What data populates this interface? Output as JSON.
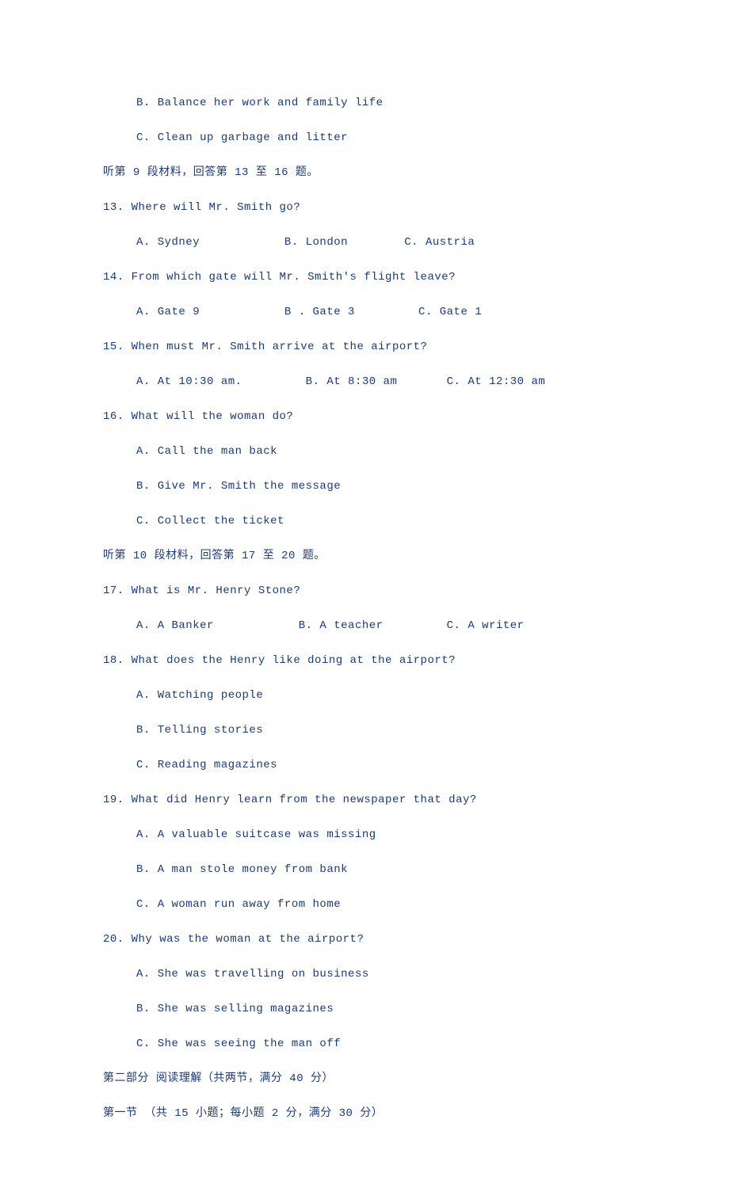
{
  "lines": [
    {
      "text": "B. Balance her work and family life",
      "indent": 1
    },
    {
      "text": "C. Clean up garbage and litter",
      "indent": 1
    },
    {
      "text": "听第 9 段材料，回答第 13 至 16 题。",
      "indent": 0
    },
    {
      "text": "13. Where will Mr. Smith go?",
      "indent": 0
    },
    {
      "text": "A. Sydney            B. London        C. Austria",
      "indent": 1
    },
    {
      "text": "14. From which gate will Mr. Smith's flight leave?",
      "indent": 0
    },
    {
      "text": "A. Gate 9            B . Gate 3         C. Gate 1",
      "indent": 1
    },
    {
      "text": "15. When must Mr. Smith arrive at the airport?",
      "indent": 0
    },
    {
      "text": "A. At 10:30 am.         B. At 8:30 am       C. At 12:30 am",
      "indent": 1
    },
    {
      "text": "16. What will the woman do?",
      "indent": 0
    },
    {
      "text": "A. Call the man back",
      "indent": 1
    },
    {
      "text": "B. Give Mr. Smith the message",
      "indent": 1
    },
    {
      "text": "C. Collect the ticket",
      "indent": 1
    },
    {
      "text": "听第 10 段材料，回答第 17 至 20 题。",
      "indent": 0
    },
    {
      "text": "17. What is Mr. Henry Stone?",
      "indent": 0
    },
    {
      "text": "A. A Banker            B. A teacher         C. A writer",
      "indent": 1
    },
    {
      "text": "18. What does the Henry like doing at the airport?",
      "indent": 0
    },
    {
      "text": "A. Watching people",
      "indent": 1
    },
    {
      "text": "B. Telling stories",
      "indent": 1
    },
    {
      "text": "C. Reading magazines",
      "indent": 1
    },
    {
      "text": "19. What did Henry learn from the newspaper that day?",
      "indent": 0
    },
    {
      "text": "A. A valuable suitcase was missing",
      "indent": 1
    },
    {
      "text": "B. A man stole money from bank",
      "indent": 1
    },
    {
      "text": "C. A woman run away from home",
      "indent": 1
    },
    {
      "text": "20. Why was the woman at the airport?",
      "indent": 0
    },
    {
      "text": "A. She was travelling on business",
      "indent": 1
    },
    {
      "text": "B. She was selling magazines",
      "indent": 1
    },
    {
      "text": "C. She was seeing the man off",
      "indent": 1
    },
    {
      "text": "第二部分 阅读理解（共两节，满分 40 分）",
      "indent": 0
    },
    {
      "text": "第一节 （共 15 小题；每小题 2 分，满分 30 分）",
      "indent": 0
    }
  ]
}
